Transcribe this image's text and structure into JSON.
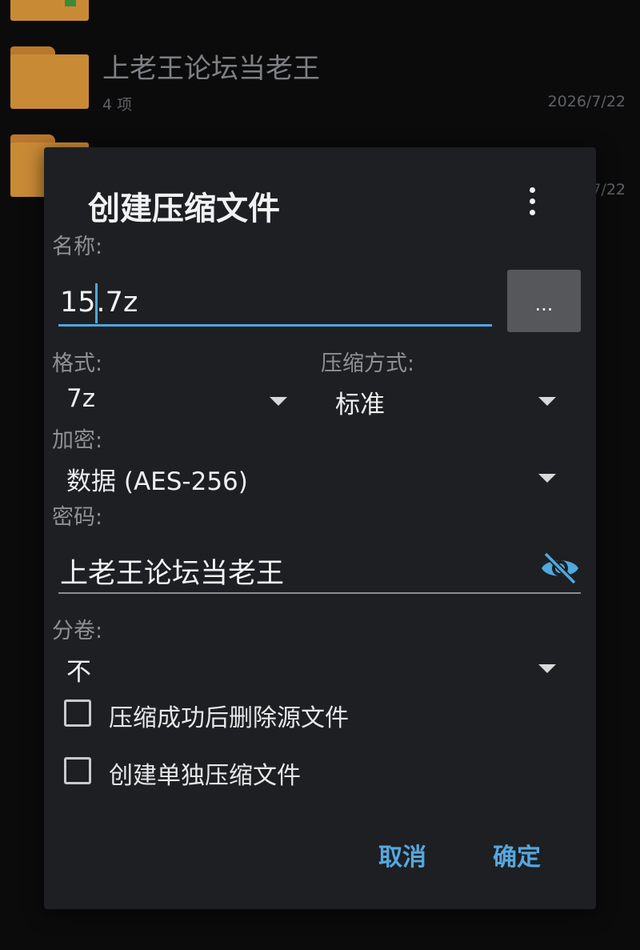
{
  "files": [
    {
      "name": "",
      "meta": "",
      "date": ""
    },
    {
      "name": "上老王论坛当老王",
      "meta": "4 项",
      "date": "2026/7/22"
    },
    {
      "name": "",
      "meta": "",
      "date": "7/22"
    }
  ],
  "dialog": {
    "title": "创建压缩文件",
    "name_label": "名称:",
    "name_value_before_caret": "15",
    "name_value_after_caret": ".7z",
    "browse_label": "...",
    "format_label": "格式:",
    "format_value": "7z",
    "compression_label": "压缩方式:",
    "compression_value": "标准",
    "encryption_label": "加密:",
    "encryption_value": "数据 (AES-256)",
    "password_label": "密码:",
    "password_value": "上老王论坛当老王",
    "split_label": "分卷:",
    "split_value": "不",
    "delete_source_label": "压缩成功后删除源文件",
    "delete_source_checked": false,
    "separate_archives_label": "创建单独压缩文件",
    "separate_archives_checked": false,
    "cancel_label": "取消",
    "ok_label": "确定"
  },
  "icons": {
    "folder": "folder-icon",
    "more": "more-vert-icon",
    "dropdown": "dropdown-arrow-icon",
    "visibility": "eye-off-icon"
  },
  "colors": {
    "accent": "#56a7df",
    "dialog_bg": "#1d1f22",
    "folder": "#c98a36"
  }
}
